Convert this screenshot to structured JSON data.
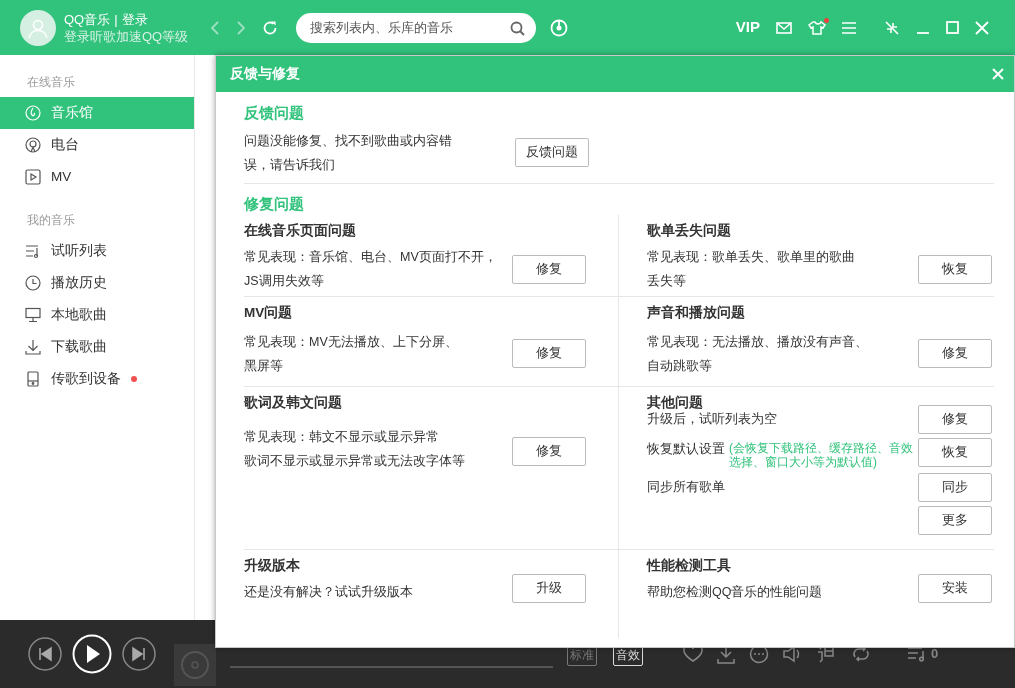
{
  "titlebar": {
    "app_name": "QQ音乐",
    "separator": "|",
    "login": "登录",
    "subtitle": "登录听歌加速QQ等级",
    "search": {
      "placeholder": "搜索列表内、乐库的音乐"
    },
    "vip": "VIP",
    "skin_notification": true
  },
  "sidebar": {
    "groups": [
      {
        "heading": "在线音乐",
        "items": [
          {
            "label": "音乐馆",
            "selected": true,
            "notification": false
          },
          {
            "label": "电台",
            "selected": false,
            "notification": false
          },
          {
            "label": "MV",
            "selected": false,
            "notification": false
          }
        ]
      },
      {
        "heading": "我的音乐",
        "items": [
          {
            "label": "试听列表",
            "selected": false,
            "notification": false
          },
          {
            "label": "播放历史",
            "selected": false,
            "notification": false
          },
          {
            "label": "本地歌曲",
            "selected": false,
            "notification": false
          },
          {
            "label": "下载歌曲",
            "selected": false,
            "notification": false
          },
          {
            "label": "传歌到设备",
            "selected": false,
            "notification": true
          }
        ]
      }
    ]
  },
  "dialog": {
    "title": "反馈与修复",
    "feedback": {
      "heading": "反馈问题",
      "lines": [
        "问题没能修复、找不到歌曲或内容错",
        "误，请告诉我们"
      ],
      "button": "反馈问题"
    },
    "repair": {
      "heading": "修复问题",
      "cells": [
        {
          "kind": "simple",
          "title": "在线音乐页面问题",
          "lines": [
            "常见表现：音乐馆、电台、MV页面打不开，",
            "JS调用失效等"
          ],
          "button": "修复"
        },
        {
          "kind": "simple",
          "title": "歌单丢失问题",
          "lines": [
            "常见表现：歌单丢失、歌单里的歌曲",
            "丢失等"
          ],
          "button": "恢复"
        },
        {
          "kind": "simple",
          "title": "MV问题",
          "lines": [
            "常见表现：MV无法播放、上下分屏、",
            "黑屏等"
          ],
          "button": "修复"
        },
        {
          "kind": "simple",
          "title": "声音和播放问题",
          "lines": [
            "常见表现：无法播放、播放没有声音、",
            "自动跳歌等"
          ],
          "button": "修复"
        },
        {
          "kind": "simple",
          "title": "歌词及韩文问题",
          "lines": [
            "常见表现：韩文不显示或显示异常",
            "歌词不显示或显示异常或无法改字体等"
          ],
          "button": "修复"
        },
        {
          "kind": "list",
          "title": "其他问题",
          "items": [
            {
              "text": "升级后，试听列表为空",
              "button": "修复"
            },
            {
              "text": "恢复默认设置",
              "note": "(会恢复下载路径、缓存路径、音效选择、窗口大小等为默认值)",
              "button": "恢复"
            },
            {
              "text": "同步所有歌单",
              "button": "同步"
            },
            {
              "button": "更多"
            }
          ]
        },
        {
          "kind": "simple",
          "title": "升级版本",
          "lines": [
            "还是没有解决？试试升级版本"
          ],
          "button": "升级"
        },
        {
          "kind": "simple",
          "title": "性能检测工具",
          "lines": [
            "帮助您检测QQ音乐的性能问题"
          ],
          "button": "安装"
        }
      ]
    }
  },
  "player": {
    "quality": "标准",
    "effect": "音效",
    "playlist_count": "0"
  }
}
